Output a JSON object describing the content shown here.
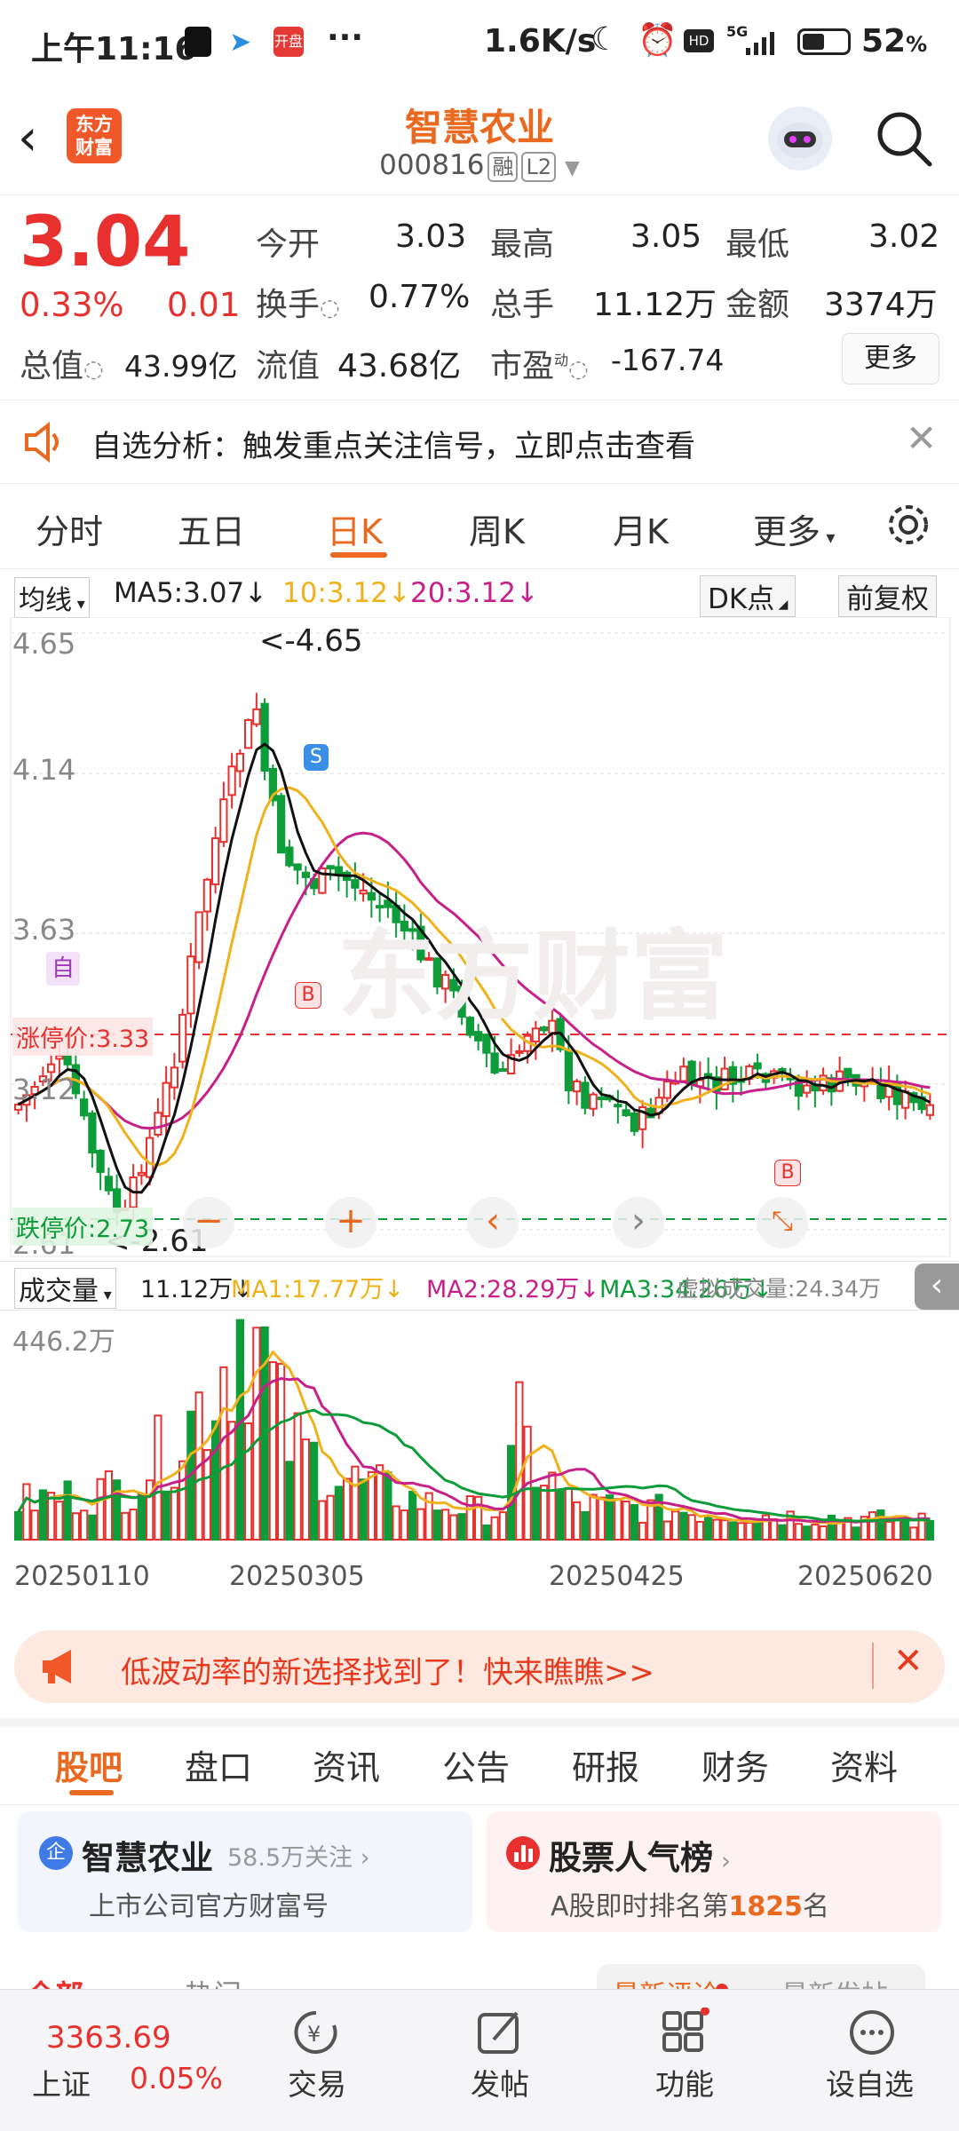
{
  "status": {
    "time": "上午11:16",
    "speed": "1.6K/s",
    "battery": "52",
    "network": "5G"
  },
  "header": {
    "logo_text": "东方财富",
    "title": "智慧农业",
    "code": "000816",
    "tag1": "融",
    "tag2": "L2"
  },
  "quote": {
    "price": "3.04",
    "change_pct": "0.33%",
    "change_amt": "0.01",
    "open_label": "今开",
    "open": "3.03",
    "high_label": "最高",
    "high": "3.05",
    "low_label": "最低",
    "low": "3.02",
    "turnover_label": "换手",
    "turnover": "0.77%",
    "volume_label": "总手",
    "volume": "11.12万",
    "amount_label": "金额",
    "amount": "3374万",
    "mktcap_label": "总值",
    "mktcap": "43.99亿",
    "float_label": "流值",
    "float": "43.68亿",
    "pe_label": "市盈",
    "pe_sup": "动",
    "pe": "-167.74",
    "more": "更多"
  },
  "alert": {
    "text": "自选分析：触发重点关注信号，立即点击查看"
  },
  "ktabs": [
    "分时",
    "五日",
    "日K",
    "周K",
    "月K",
    "更多"
  ],
  "ma_bar": {
    "type": "均线",
    "ma5": "MA5:3.07",
    "ma10": "10:3.12",
    "ma20": "20:3.12",
    "dk": "DK点",
    "adjust": "前复权"
  },
  "chart_data": {
    "type": "candlestick",
    "y_ticks": [
      "4.65",
      "4.14",
      "3.63",
      "3.12",
      "2.61"
    ],
    "high_label": "<-4.65",
    "low_label": "<-2.61",
    "limit_up": "涨停价:3.33",
    "limit_down": "跌停价:2.73",
    "markers": {
      "zi": "自",
      "s": "S",
      "b1": "B",
      "b2": "B"
    },
    "x_labels": [
      "20250110",
      "20250305",
      "20250425",
      "20250620"
    ]
  },
  "vol_bar": {
    "type": "成交量",
    "vol": "11.12万",
    "ma1": "MA1:17.77万",
    "ma2": "MA2:28.29万",
    "ma3": "MA3:34.26万",
    "virtual": "虚拟成交量:24.34万",
    "max": "446.2万"
  },
  "banner": {
    "text": "低波动率的新选择找到了！快来瞧瞧>>"
  },
  "btabs": [
    "股吧",
    "盘口",
    "资讯",
    "公告",
    "研报",
    "财务",
    "资料"
  ],
  "card1": {
    "name": "智慧农业",
    "follow": "58.5万关注",
    "desc": "上市公司官方财富号"
  },
  "card2": {
    "name": "股票人气榜",
    "desc_pre": "A股即时排名第",
    "rank": "1825",
    "desc_post": "名"
  },
  "peek": {
    "a": "全部",
    "b": "热门",
    "c": "最新评论",
    "d": "最新发帖"
  },
  "nav": {
    "index_val": "3363.69",
    "index_name": "上证",
    "index_pct": "0.05%",
    "trade": "交易",
    "post": "发帖",
    "func": "功能",
    "watch": "设自选"
  },
  "colors": {
    "up": "#e8312f",
    "down": "#0d9c3a",
    "accent": "#e8691f",
    "ma10": "#f0b21c",
    "ma20": "#c8208a"
  }
}
